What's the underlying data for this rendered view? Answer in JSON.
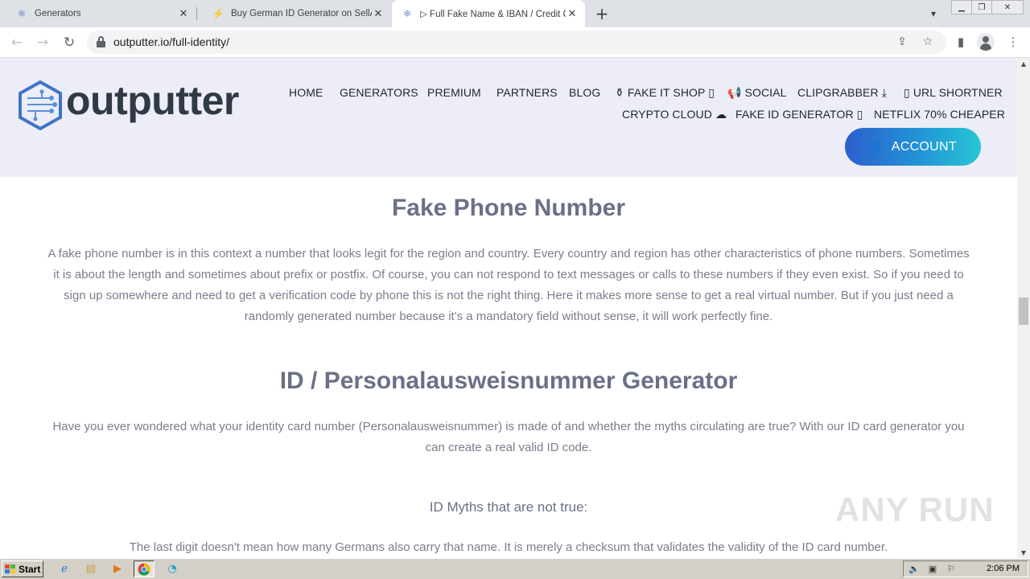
{
  "browser": {
    "tabs": [
      {
        "title": "Generators",
        "icon": "outputter-favicon",
        "active": false
      },
      {
        "title": "Buy German ID Generator on SellApp",
        "icon": "sellapp-favicon",
        "active": false
      },
      {
        "title": "▷ Full Fake Name & IBAN / Credit Ca",
        "icon": "outputter-favicon",
        "active": true
      }
    ],
    "new_tab": "+",
    "url": "outputter.io/full-identity/"
  },
  "site": {
    "logo_text": "outputter",
    "nav": {
      "home": "HOME",
      "generators": "GENERATORS",
      "premium": "PREMIUM",
      "partners": "PARTNERS",
      "blog": "BLOG",
      "fake_it_shop": "FAKE IT SHOP",
      "social": "SOCIAL",
      "clipgrabber": "CLIPGRABBER",
      "url_shortner": "URL SHORTNER",
      "crypto_cloud": "CRYPTO CLOUD",
      "fake_id_generator": "FAKE ID GENERATOR",
      "netflix": "NETFLIX 70% CHEAPER"
    },
    "account_button": "ACCOUNT",
    "brand_colors": {
      "header_bg": "#ecedf7",
      "button_from": "#2c5fce",
      "button_to": "#27c7d3"
    }
  },
  "content": {
    "phone_heading": "Fake Phone Number",
    "phone_text": "A fake phone number is in this context a number that looks legit for the region and country. Every country and region has other characteristics of phone numbers. Sometimes it is about the length and sometimes about prefix or postfix. Of course, you can not respond to text messages or calls to these numbers if they even exist. So if you need to sign up somewhere and need to get a verification code by phone this is not the right thing. Here it makes more sense to get a real virtual number. But if you just need a randomly generated number because it's a mandatory field without sense, it will work perfectly fine.",
    "id_heading": "ID / Personalausweisnummer Generator",
    "id_text": "Have you ever wondered what your identity card number (Personalausweisnummer) is made of and whether the myths circulating are true? With our ID card generator you can create a real valid ID code.",
    "myths_heading": "ID Myths that are not true:",
    "myth_1": "The last digit doesn't mean how many Germans also carry that name. It is merely a checksum that validates the validity of the ID card number."
  },
  "watermark": "ANY RUN",
  "taskbar": {
    "start_label": "Start",
    "clock": "2:06 PM"
  }
}
